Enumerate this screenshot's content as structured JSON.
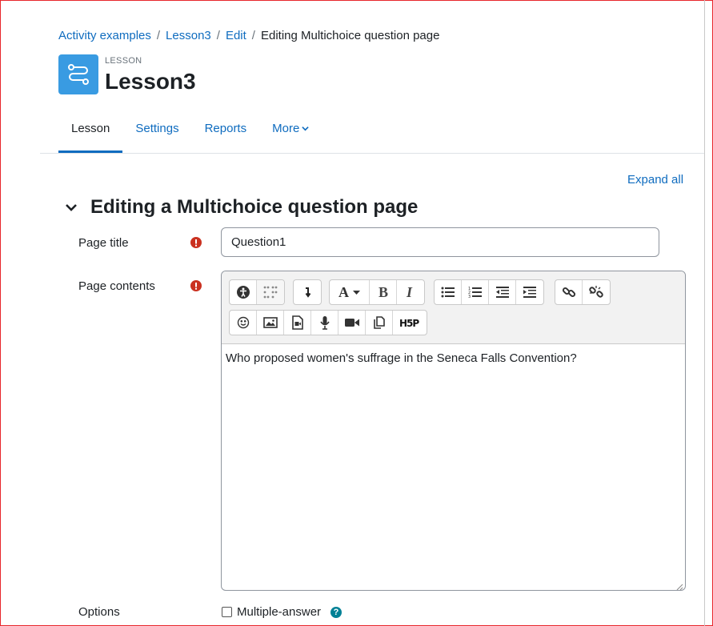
{
  "breadcrumb": [
    {
      "label": "Activity examples",
      "link": true
    },
    {
      "label": "Lesson3",
      "link": true
    },
    {
      "label": "Edit",
      "link": true
    },
    {
      "label": "Editing Multichoice question page",
      "link": false
    }
  ],
  "header": {
    "module_label": "LESSON",
    "title": "Lesson3",
    "icon": "lesson-path-icon",
    "icon_color": "#399be2"
  },
  "tabs": [
    {
      "label": "Lesson",
      "active": true
    },
    {
      "label": "Settings",
      "active": false
    },
    {
      "label": "Reports",
      "active": false
    },
    {
      "label": "More",
      "active": false,
      "dropdown": true
    }
  ],
  "expand_all": "Expand all",
  "section": {
    "title": "Editing a Multichoice question page"
  },
  "form": {
    "page_title_label": "Page title",
    "page_title_value": "Question1",
    "page_contents_label": "Page contents",
    "page_contents_text": "Who proposed women's suffrage in the Seneca Falls Convention?",
    "options_label": "Options",
    "multiple_answer_label": "Multiple-answer",
    "multiple_answer_checked": false
  },
  "colors": {
    "link": "#0f6cbf",
    "required": "#ca3120",
    "help": "#008196"
  }
}
